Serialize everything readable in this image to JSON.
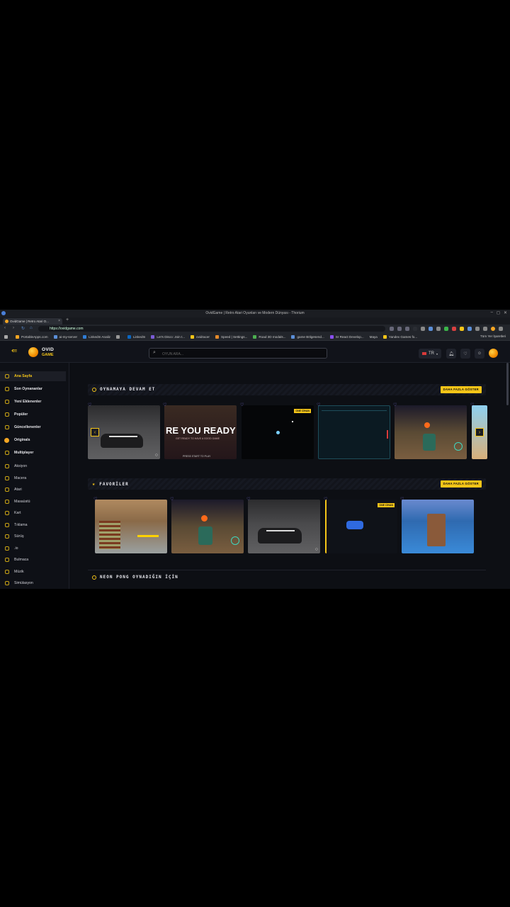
{
  "window": {
    "title": "OvidGame | Retro Atari Oyunları ve Modern Dünyası - Thorium"
  },
  "tab": {
    "label": "OvidGame | Retro Atari O..."
  },
  "address": {
    "url": "https://ovidgame.com"
  },
  "bookmarks": [
    "PortableApps.com",
    "ai-my-server",
    "LinkedIn Analiz",
    "",
    "LinkedIn",
    "Let's Disco: Join t...",
    "ovidracer",
    "Speed | Settings...",
    "Road 3D modals...",
    "game Bölgesend...",
    "Sr React Develop...",
    "Maya",
    "Yandex Games fo..."
  ],
  "bookmarks_right": "Tüm Yer İşaretleri",
  "site": {
    "logo_line1": "OVID",
    "logo_line2": "GAME",
    "search_placeholder": "OYUN ARA...",
    "lang": "TR"
  },
  "sidebar": {
    "items": [
      {
        "label": "Ana Sayfa"
      },
      {
        "label": "Son Oynananlar"
      },
      {
        "label": "Yeni Eklenenler"
      },
      {
        "label": "Popüler"
      },
      {
        "label": "Güncellenenler"
      },
      {
        "label": "Originals"
      },
      {
        "label": "Multiplayer"
      },
      {
        "label": "Aksiyon"
      },
      {
        "label": "Macera"
      },
      {
        "label": "Atari"
      },
      {
        "label": "Masaüstü"
      },
      {
        "label": "Kart"
      },
      {
        "label": "Tıklama"
      },
      {
        "label": "Sürüş"
      },
      {
        "label": ".io"
      },
      {
        "label": "Bulmaca"
      },
      {
        "label": "Müzik"
      },
      {
        "label": "Simülasyon"
      }
    ]
  },
  "sections": {
    "continue": {
      "title": "OYNAMAYA DEVAM ET",
      "more": "DAHA FAZLA GÖSTER"
    },
    "favorites": {
      "title": "FAVORİLER",
      "more": "DAHA FAZLA GÖSTER"
    },
    "because": {
      "title": "NEON PONG OYNADIĞIN İÇİN"
    }
  },
  "cards": {
    "badge": "ONE CİHAN",
    "ready_text": "RE YOU READY",
    "ready_sub": "GET READY TO HAVE A GOOD GAME",
    "ready_small": "PRESS START TO PLAY"
  }
}
